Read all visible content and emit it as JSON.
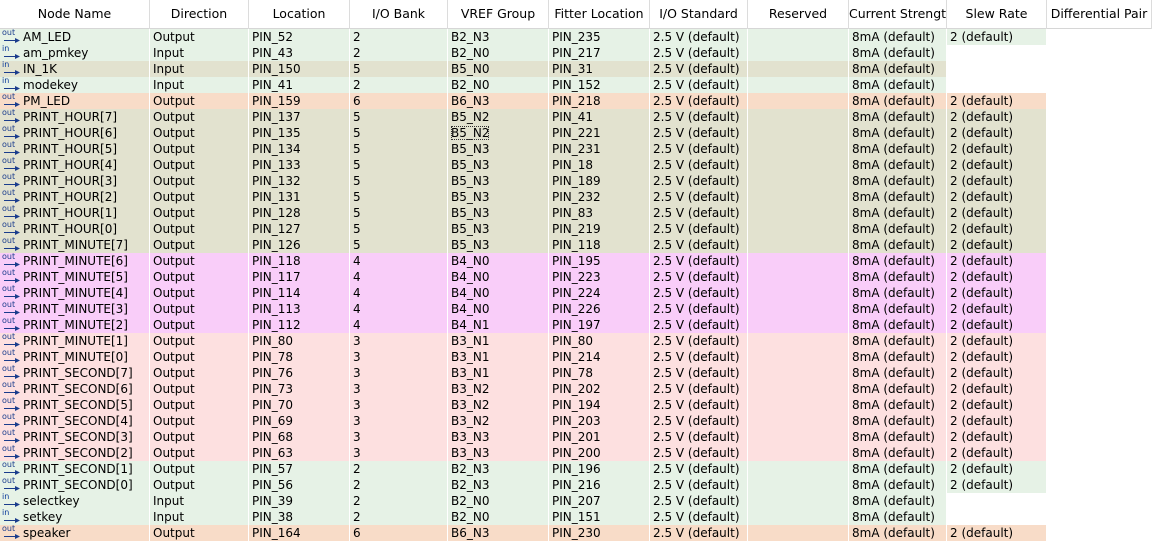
{
  "columns": [
    "Node Name",
    "Direction",
    "Location",
    "I/O Bank",
    "VREF Group",
    "Fitter Location",
    "I/O Standard",
    "Reserved",
    "Current Strength",
    "Slew Rate",
    "Differential Pair"
  ],
  "colors": {
    "green": "#e6f2e6",
    "khaki": "#e2e2cf",
    "orange": "#f8dcc8",
    "magenta": "#f9cdf9",
    "pink": "#fde0e0",
    "icon_blue": "#1a3c8c"
  },
  "rows": [
    {
      "name": "AM_LED",
      "dir": "Output",
      "loc": "PIN_52",
      "bank": "2",
      "vref": "B2_N3",
      "fit": "PIN_235",
      "std": "2.5 V (default)",
      "res": "",
      "cur": "8mA (default)",
      "slew": "2 (default)",
      "diff": "",
      "color": "green",
      "icon": "out"
    },
    {
      "name": "am_pmkey",
      "dir": "Input",
      "loc": "PIN_43",
      "bank": "2",
      "vref": "B2_N0",
      "fit": "PIN_217",
      "std": "2.5 V (default)",
      "res": "",
      "cur": "8mA (default)",
      "slew": "",
      "diff": "",
      "color": "green",
      "icon": "in"
    },
    {
      "name": "IN_1K",
      "dir": "Input",
      "loc": "PIN_150",
      "bank": "5",
      "vref": "B5_N0",
      "fit": "PIN_31",
      "std": "2.5 V (default)",
      "res": "",
      "cur": "8mA (default)",
      "slew": "",
      "diff": "",
      "color": "khaki",
      "icon": "in"
    },
    {
      "name": "modekey",
      "dir": "Input",
      "loc": "PIN_41",
      "bank": "2",
      "vref": "B2_N0",
      "fit": "PIN_152",
      "std": "2.5 V (default)",
      "res": "",
      "cur": "8mA (default)",
      "slew": "",
      "diff": "",
      "color": "green",
      "icon": "in"
    },
    {
      "name": "PM_LED",
      "dir": "Output",
      "loc": "PIN_159",
      "bank": "6",
      "vref": "B6_N3",
      "fit": "PIN_218",
      "std": "2.5 V (default)",
      "res": "",
      "cur": "8mA (default)",
      "slew": "2 (default)",
      "diff": "",
      "color": "orange",
      "icon": "out"
    },
    {
      "name": "PRINT_HOUR[7]",
      "dir": "Output",
      "loc": "PIN_137",
      "bank": "5",
      "vref": "B5_N2",
      "fit": "PIN_41",
      "std": "2.5 V (default)",
      "res": "",
      "cur": "8mA (default)",
      "slew": "2 (default)",
      "diff": "",
      "color": "khaki",
      "icon": "out"
    },
    {
      "name": "PRINT_HOUR[6]",
      "dir": "Output",
      "loc": "PIN_135",
      "bank": "5",
      "vref": "B5_N2",
      "fit": "PIN_221",
      "std": "2.5 V (default)",
      "res": "",
      "cur": "8mA (default)",
      "slew": "2 (default)",
      "diff": "",
      "color": "khaki",
      "icon": "out",
      "focus": true
    },
    {
      "name": "PRINT_HOUR[5]",
      "dir": "Output",
      "loc": "PIN_134",
      "bank": "5",
      "vref": "B5_N3",
      "fit": "PIN_231",
      "std": "2.5 V (default)",
      "res": "",
      "cur": "8mA (default)",
      "slew": "2 (default)",
      "diff": "",
      "color": "khaki",
      "icon": "out"
    },
    {
      "name": "PRINT_HOUR[4]",
      "dir": "Output",
      "loc": "PIN_133",
      "bank": "5",
      "vref": "B5_N3",
      "fit": "PIN_18",
      "std": "2.5 V (default)",
      "res": "",
      "cur": "8mA (default)",
      "slew": "2 (default)",
      "diff": "",
      "color": "khaki",
      "icon": "out"
    },
    {
      "name": "PRINT_HOUR[3]",
      "dir": "Output",
      "loc": "PIN_132",
      "bank": "5",
      "vref": "B5_N3",
      "fit": "PIN_189",
      "std": "2.5 V (default)",
      "res": "",
      "cur": "8mA (default)",
      "slew": "2 (default)",
      "diff": "",
      "color": "khaki",
      "icon": "out"
    },
    {
      "name": "PRINT_HOUR[2]",
      "dir": "Output",
      "loc": "PIN_131",
      "bank": "5",
      "vref": "B5_N3",
      "fit": "PIN_232",
      "std": "2.5 V (default)",
      "res": "",
      "cur": "8mA (default)",
      "slew": "2 (default)",
      "diff": "",
      "color": "khaki",
      "icon": "out"
    },
    {
      "name": "PRINT_HOUR[1]",
      "dir": "Output",
      "loc": "PIN_128",
      "bank": "5",
      "vref": "B5_N3",
      "fit": "PIN_83",
      "std": "2.5 V (default)",
      "res": "",
      "cur": "8mA (default)",
      "slew": "2 (default)",
      "diff": "",
      "color": "khaki",
      "icon": "out"
    },
    {
      "name": "PRINT_HOUR[0]",
      "dir": "Output",
      "loc": "PIN_127",
      "bank": "5",
      "vref": "B5_N3",
      "fit": "PIN_219",
      "std": "2.5 V (default)",
      "res": "",
      "cur": "8mA (default)",
      "slew": "2 (default)",
      "diff": "",
      "color": "khaki",
      "icon": "out"
    },
    {
      "name": "PRINT_MINUTE[7]",
      "dir": "Output",
      "loc": "PIN_126",
      "bank": "5",
      "vref": "B5_N3",
      "fit": "PIN_118",
      "std": "2.5 V (default)",
      "res": "",
      "cur": "8mA (default)",
      "slew": "2 (default)",
      "diff": "",
      "color": "khaki",
      "icon": "out"
    },
    {
      "name": "PRINT_MINUTE[6]",
      "dir": "Output",
      "loc": "PIN_118",
      "bank": "4",
      "vref": "B4_N0",
      "fit": "PIN_195",
      "std": "2.5 V (default)",
      "res": "",
      "cur": "8mA (default)",
      "slew": "2 (default)",
      "diff": "",
      "color": "magenta",
      "icon": "out"
    },
    {
      "name": "PRINT_MINUTE[5]",
      "dir": "Output",
      "loc": "PIN_117",
      "bank": "4",
      "vref": "B4_N0",
      "fit": "PIN_223",
      "std": "2.5 V (default)",
      "res": "",
      "cur": "8mA (default)",
      "slew": "2 (default)",
      "diff": "",
      "color": "magenta",
      "icon": "out"
    },
    {
      "name": "PRINT_MINUTE[4]",
      "dir": "Output",
      "loc": "PIN_114",
      "bank": "4",
      "vref": "B4_N0",
      "fit": "PIN_224",
      "std": "2.5 V (default)",
      "res": "",
      "cur": "8mA (default)",
      "slew": "2 (default)",
      "diff": "",
      "color": "magenta",
      "icon": "out"
    },
    {
      "name": "PRINT_MINUTE[3]",
      "dir": "Output",
      "loc": "PIN_113",
      "bank": "4",
      "vref": "B4_N0",
      "fit": "PIN_226",
      "std": "2.5 V (default)",
      "res": "",
      "cur": "8mA (default)",
      "slew": "2 (default)",
      "diff": "",
      "color": "magenta",
      "icon": "out"
    },
    {
      "name": "PRINT_MINUTE[2]",
      "dir": "Output",
      "loc": "PIN_112",
      "bank": "4",
      "vref": "B4_N1",
      "fit": "PIN_197",
      "std": "2.5 V (default)",
      "res": "",
      "cur": "8mA (default)",
      "slew": "2 (default)",
      "diff": "",
      "color": "magenta",
      "icon": "out"
    },
    {
      "name": "PRINT_MINUTE[1]",
      "dir": "Output",
      "loc": "PIN_80",
      "bank": "3",
      "vref": "B3_N1",
      "fit": "PIN_80",
      "std": "2.5 V (default)",
      "res": "",
      "cur": "8mA (default)",
      "slew": "2 (default)",
      "diff": "",
      "color": "pink",
      "icon": "out"
    },
    {
      "name": "PRINT_MINUTE[0]",
      "dir": "Output",
      "loc": "PIN_78",
      "bank": "3",
      "vref": "B3_N1",
      "fit": "PIN_214",
      "std": "2.5 V (default)",
      "res": "",
      "cur": "8mA (default)",
      "slew": "2 (default)",
      "diff": "",
      "color": "pink",
      "icon": "out"
    },
    {
      "name": "PRINT_SECOND[7]",
      "dir": "Output",
      "loc": "PIN_76",
      "bank": "3",
      "vref": "B3_N1",
      "fit": "PIN_78",
      "std": "2.5 V (default)",
      "res": "",
      "cur": "8mA (default)",
      "slew": "2 (default)",
      "diff": "",
      "color": "pink",
      "icon": "out"
    },
    {
      "name": "PRINT_SECOND[6]",
      "dir": "Output",
      "loc": "PIN_73",
      "bank": "3",
      "vref": "B3_N2",
      "fit": "PIN_202",
      "std": "2.5 V (default)",
      "res": "",
      "cur": "8mA (default)",
      "slew": "2 (default)",
      "diff": "",
      "color": "pink",
      "icon": "out"
    },
    {
      "name": "PRINT_SECOND[5]",
      "dir": "Output",
      "loc": "PIN_70",
      "bank": "3",
      "vref": "B3_N2",
      "fit": "PIN_194",
      "std": "2.5 V (default)",
      "res": "",
      "cur": "8mA (default)",
      "slew": "2 (default)",
      "diff": "",
      "color": "pink",
      "icon": "out"
    },
    {
      "name": "PRINT_SECOND[4]",
      "dir": "Output",
      "loc": "PIN_69",
      "bank": "3",
      "vref": "B3_N2",
      "fit": "PIN_203",
      "std": "2.5 V (default)",
      "res": "",
      "cur": "8mA (default)",
      "slew": "2 (default)",
      "diff": "",
      "color": "pink",
      "icon": "out"
    },
    {
      "name": "PRINT_SECOND[3]",
      "dir": "Output",
      "loc": "PIN_68",
      "bank": "3",
      "vref": "B3_N3",
      "fit": "PIN_201",
      "std": "2.5 V (default)",
      "res": "",
      "cur": "8mA (default)",
      "slew": "2 (default)",
      "diff": "",
      "color": "pink",
      "icon": "out"
    },
    {
      "name": "PRINT_SECOND[2]",
      "dir": "Output",
      "loc": "PIN_63",
      "bank": "3",
      "vref": "B3_N3",
      "fit": "PIN_200",
      "std": "2.5 V (default)",
      "res": "",
      "cur": "8mA (default)",
      "slew": "2 (default)",
      "diff": "",
      "color": "pink",
      "icon": "out"
    },
    {
      "name": "PRINT_SECOND[1]",
      "dir": "Output",
      "loc": "PIN_57",
      "bank": "2",
      "vref": "B2_N3",
      "fit": "PIN_196",
      "std": "2.5 V (default)",
      "res": "",
      "cur": "8mA (default)",
      "slew": "2 (default)",
      "diff": "",
      "color": "green",
      "icon": "out"
    },
    {
      "name": "PRINT_SECOND[0]",
      "dir": "Output",
      "loc": "PIN_56",
      "bank": "2",
      "vref": "B2_N3",
      "fit": "PIN_216",
      "std": "2.5 V (default)",
      "res": "",
      "cur": "8mA (default)",
      "slew": "2 (default)",
      "diff": "",
      "color": "green",
      "icon": "out"
    },
    {
      "name": "selectkey",
      "dir": "Input",
      "loc": "PIN_39",
      "bank": "2",
      "vref": "B2_N0",
      "fit": "PIN_207",
      "std": "2.5 V (default)",
      "res": "",
      "cur": "8mA (default)",
      "slew": "",
      "diff": "",
      "color": "green",
      "icon": "in"
    },
    {
      "name": "setkey",
      "dir": "Input",
      "loc": "PIN_38",
      "bank": "2",
      "vref": "B2_N0",
      "fit": "PIN_151",
      "std": "2.5 V (default)",
      "res": "",
      "cur": "8mA (default)",
      "slew": "",
      "diff": "",
      "color": "green",
      "icon": "in"
    },
    {
      "name": "speaker",
      "dir": "Output",
      "loc": "PIN_164",
      "bank": "6",
      "vref": "B6_N3",
      "fit": "PIN_230",
      "std": "2.5 V (default)",
      "res": "",
      "cur": "8mA (default)",
      "slew": "2 (default)",
      "diff": "",
      "color": "orange",
      "icon": "out"
    }
  ]
}
